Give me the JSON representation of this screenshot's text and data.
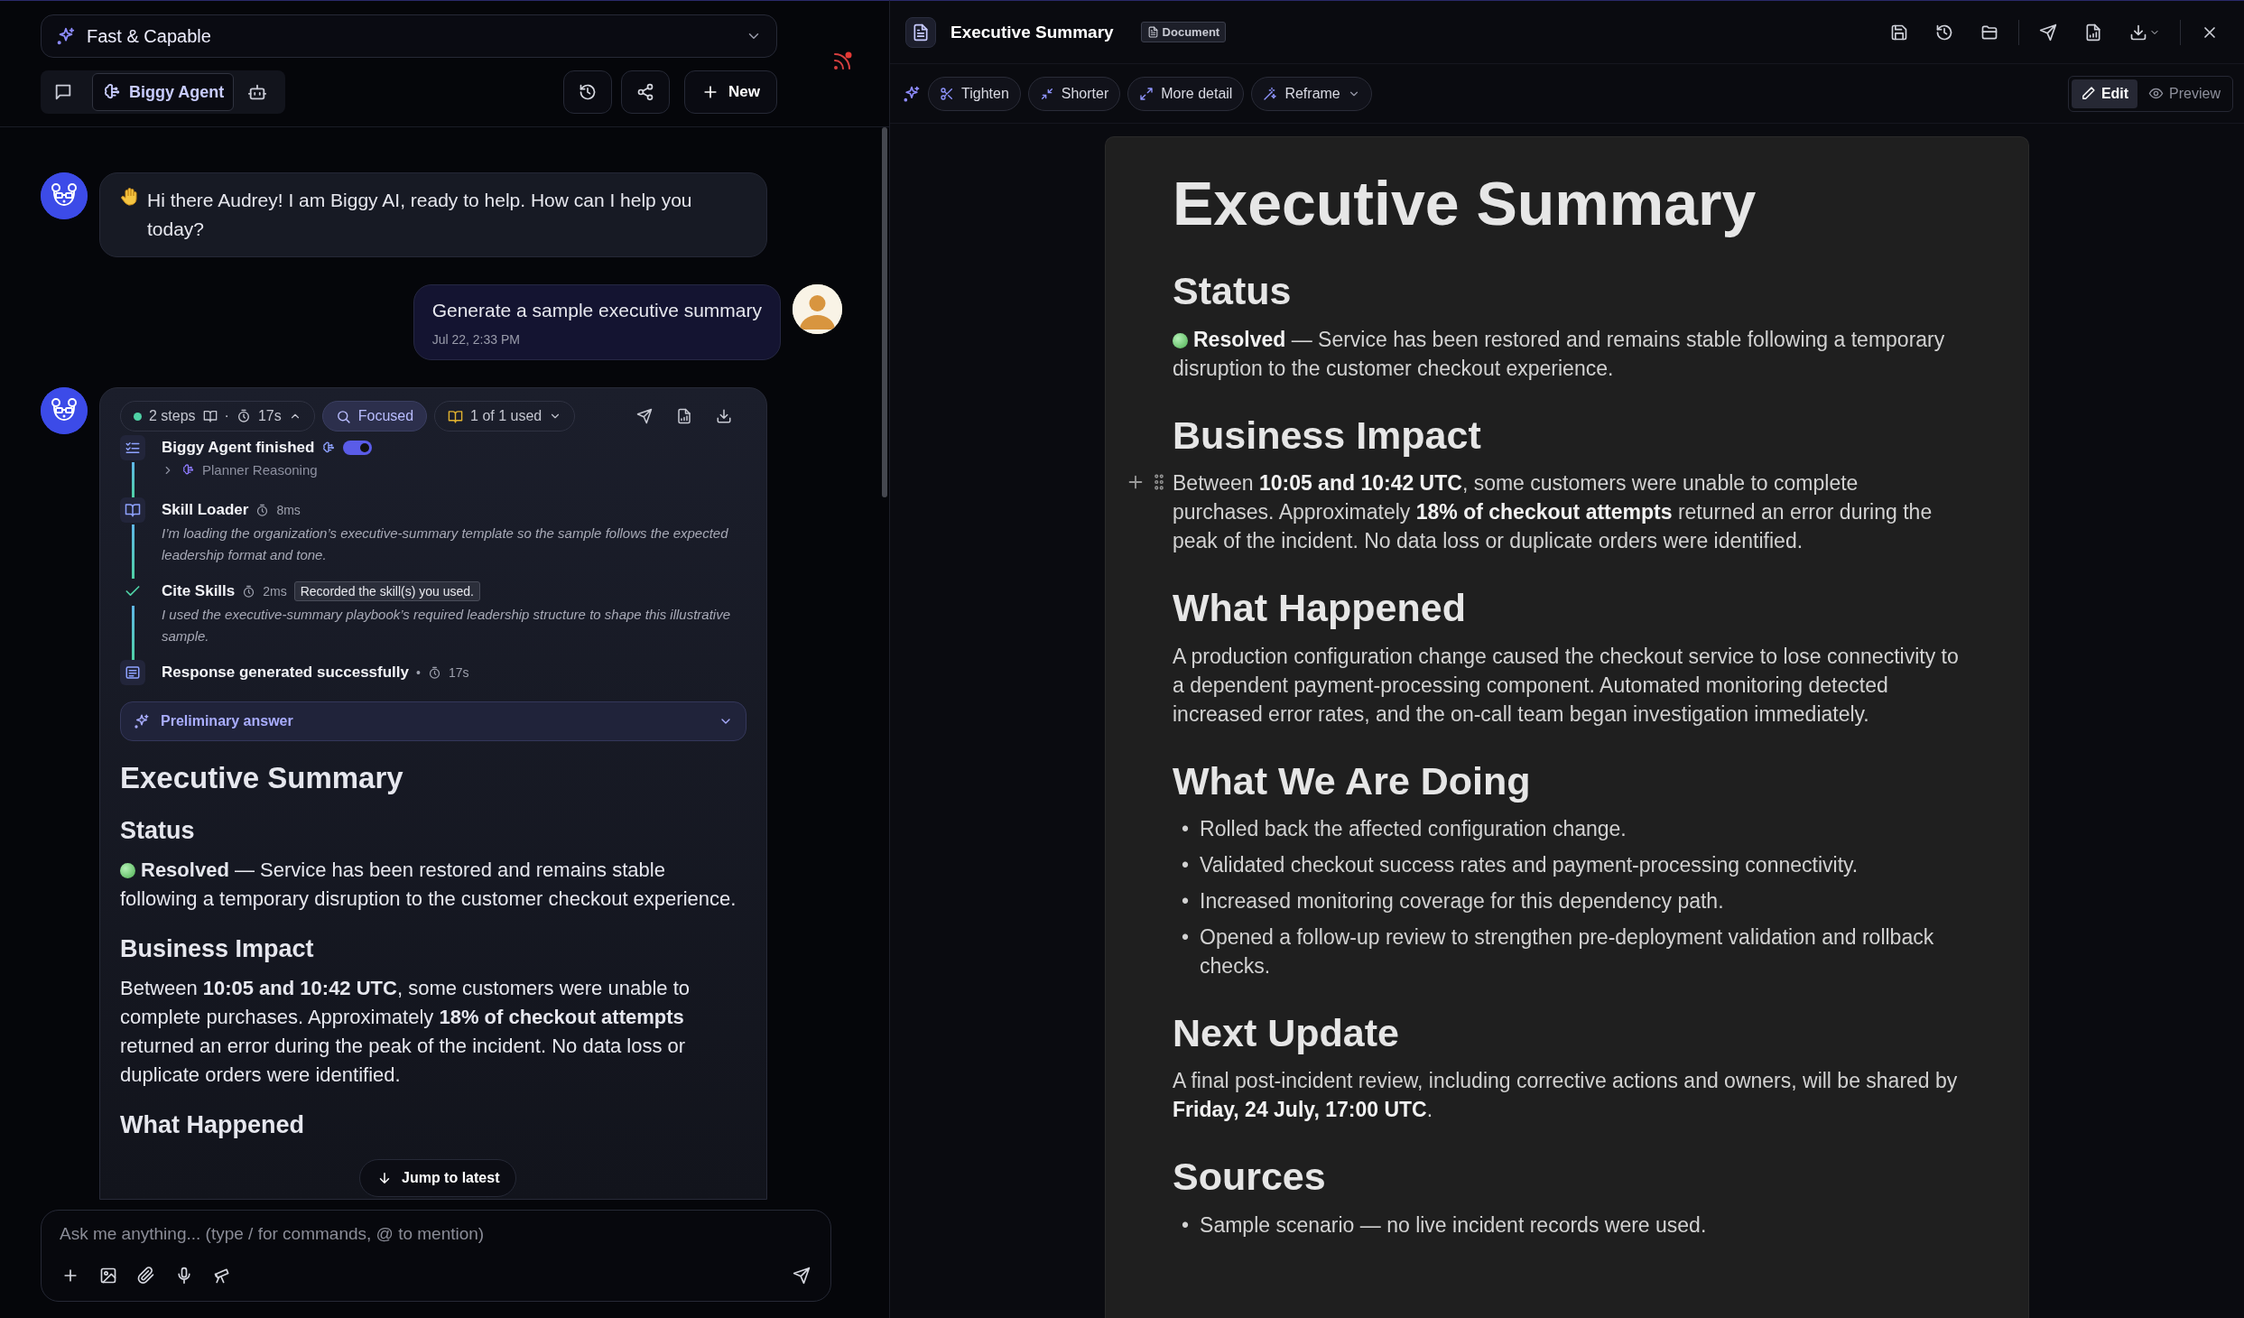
{
  "chat_panel": {
    "model_select": {
      "value": "Fast & Capable"
    },
    "mode_tabs": [
      {
        "kind": "chat",
        "selected": false
      },
      {
        "kind": "agent",
        "label": "Biggy Agent",
        "selected": true
      },
      {
        "kind": "bot",
        "selected": false
      }
    ],
    "new_button": "New",
    "messages": [
      {
        "kind": "assistant",
        "text": "Hi there Audrey! I am Biggy AI, ready to help. How can I help you today?"
      },
      {
        "kind": "user",
        "text": "Generate a sample executive summary",
        "time": "Jul 22, 2:33 PM"
      },
      {
        "kind": "agent_run",
        "run_summary": {
          "steps": "2 steps",
          "separator": "·",
          "duration": "17s",
          "expanded": true
        },
        "mode_chip": {
          "label": "Focused",
          "selected": true
        },
        "skills_chip": "1 of 1 used",
        "steps": [
          {
            "kind": "checklist",
            "title": "Biggy Agent finished",
            "toggle_on": true,
            "sub": "Planner Reasoning"
          },
          {
            "kind": "skill",
            "title": "Skill Loader",
            "duration": "8ms",
            "note": "I’m loading the organization’s executive-summary template so the sample follows the expected leadership format and tone."
          },
          {
            "kind": "check",
            "title": "Cite Skills",
            "duration": "2ms",
            "badge": "Recorded the skill(s) you used.",
            "note": "I used the executive-summary playbook’s required leadership structure to shape this illustrative sample."
          },
          {
            "kind": "response",
            "title": "Response generated successfully",
            "separator": "•",
            "duration": "17s"
          }
        ],
        "preliminary": {
          "label": "Preliminary answer",
          "expanded": false
        },
        "answer": [
          {
            "kind": "h1",
            "text": "Executive Summary"
          },
          {
            "kind": "h2",
            "text": "Status"
          },
          {
            "kind": "status",
            "text": "**Resolved** — Service has been restored and remains stable following a temporary disruption to the customer checkout experience."
          },
          {
            "kind": "h2",
            "text": "Business Impact"
          },
          {
            "kind": "p",
            "text": "Between **10:05 and 10:42 UTC**, some customers were unable to complete purchases. Approximately **18% of checkout attempts** returned an error during the peak of the incident. No data loss or duplicate orders were identified."
          },
          {
            "kind": "h2",
            "text": "What Happened"
          }
        ]
      }
    ],
    "jump_button": "Jump to latest",
    "composer": {
      "placeholder": "Ask me anything... (type / for commands, @ to mention)"
    }
  },
  "document_panel": {
    "title": "Executive Summary",
    "badge": "Document",
    "ai_actions": [
      {
        "label": "Tighten",
        "kind": "tighten"
      },
      {
        "label": "Shorter",
        "kind": "shorter"
      },
      {
        "label": "More detail",
        "kind": "expand"
      },
      {
        "label": "Reframe",
        "kind": "reframe",
        "menu": true
      }
    ],
    "view_tabs": [
      {
        "label": "Edit",
        "kind": "edit",
        "selected": true
      },
      {
        "label": "Preview",
        "kind": "preview",
        "selected": false
      }
    ],
    "blocks": [
      {
        "kind": "h1",
        "text": "Executive Summary"
      },
      {
        "kind": "h2",
        "text": "Status"
      },
      {
        "kind": "status",
        "text": "**Resolved** — Service has been restored and remains stable following a temporary disruption to the customer checkout experience."
      },
      {
        "kind": "h2",
        "text": "Business Impact"
      },
      {
        "kind": "p",
        "handle": true,
        "text": "Between **10:05 and 10:42 UTC**, some customers were unable to complete purchases. Approximately **18% of checkout attempts** returned an error during the peak of the incident. No data loss or duplicate orders were identified."
      },
      {
        "kind": "h2",
        "text": "What Happened"
      },
      {
        "kind": "p",
        "text": "A production configuration change caused the checkout service to lose connectivity to a dependent payment-processing component. Automated monitoring detected increased error rates, and the on-call team began investigation immediately."
      },
      {
        "kind": "h2",
        "text": "What We Are Doing"
      },
      {
        "kind": "ul",
        "marker": "•",
        "items": [
          "Rolled back the affected configuration change.",
          "Validated checkout success rates and payment-processing connectivity.",
          "Increased monitoring coverage for this dependency path.",
          "Opened a follow-up review to strengthen pre-deployment validation and rollback checks."
        ]
      },
      {
        "kind": "h2",
        "text": "Next Update"
      },
      {
        "kind": "p",
        "text": "A final post-incident review, including corrective actions and owners, will be shared by **Friday, 24 July, 17:00 UTC**."
      },
      {
        "kind": "h2",
        "text": "Sources"
      },
      {
        "kind": "ul",
        "marker": "•",
        "items": [
          "Sample scenario — no live incident records were used."
        ]
      }
    ]
  }
}
